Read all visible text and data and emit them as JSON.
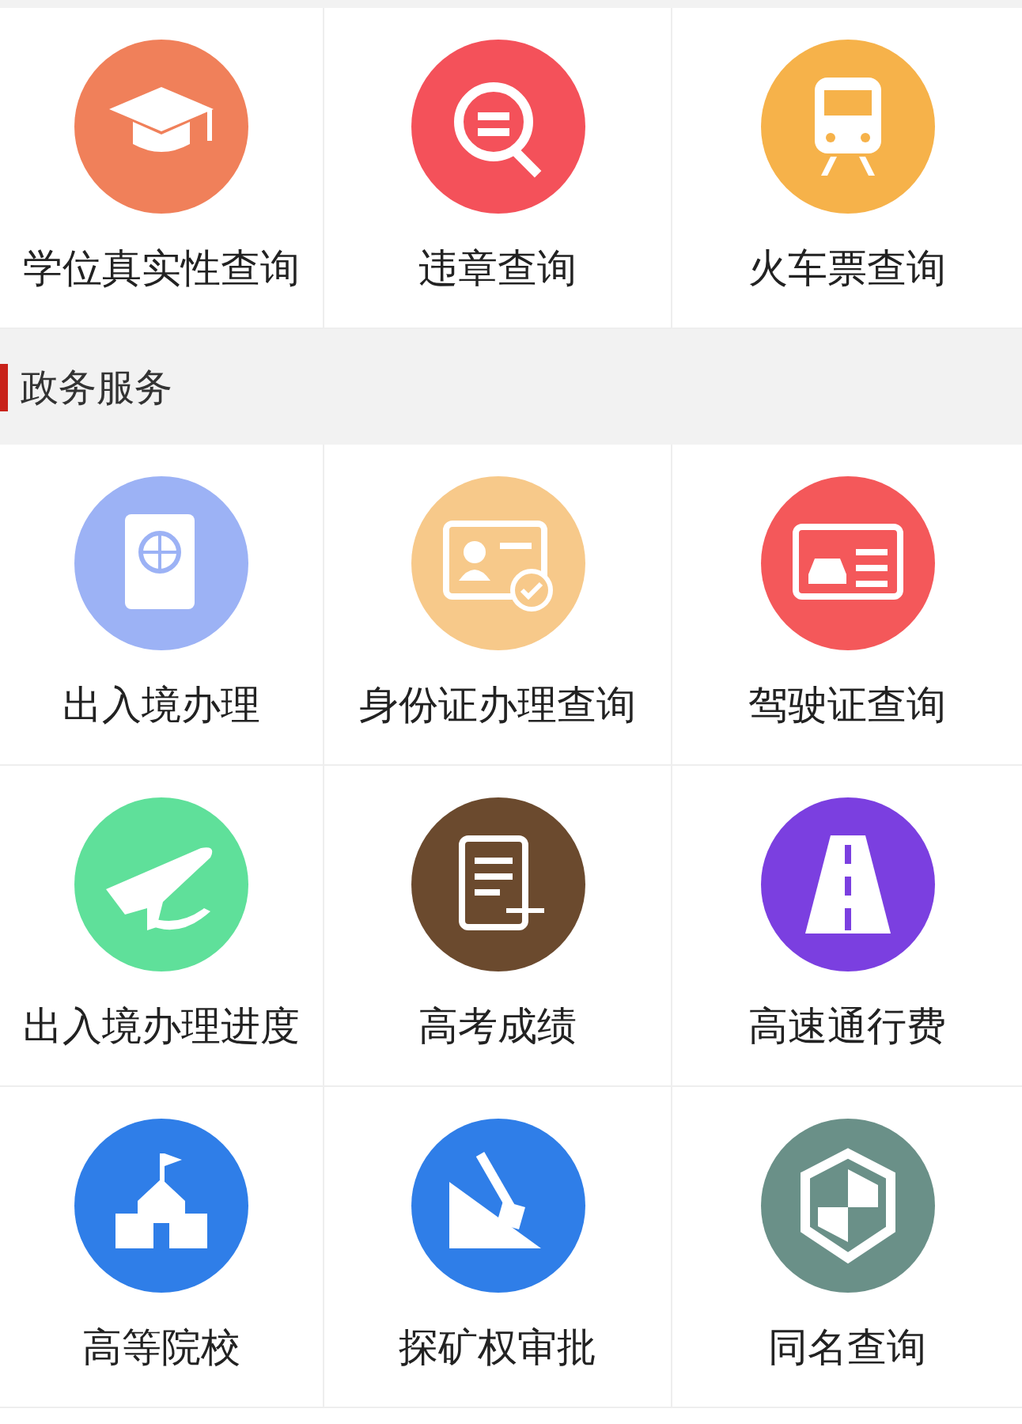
{
  "sections": [
    {
      "items": [
        {
          "label": "学位真实性查询",
          "color": "#f0805a"
        },
        {
          "label": "违章查询",
          "color": "#f4515a"
        },
        {
          "label": "火车票查询",
          "color": "#f6b24a"
        }
      ]
    },
    {
      "title": "政务服务",
      "items": [
        {
          "label": "出入境办理",
          "color": "#9cb2f5"
        },
        {
          "label": "身份证办理查询",
          "color": "#f7c98a"
        },
        {
          "label": "驾驶证查询",
          "color": "#f4585a"
        },
        {
          "label": "出入境办理进度",
          "color": "#5fe09a"
        },
        {
          "label": "高考成绩",
          "color": "#6b4a2e"
        },
        {
          "label": "高速通行费",
          "color": "#7b3fe0"
        },
        {
          "label": "高等院校",
          "color": "#2f7ee8"
        },
        {
          "label": "探矿权审批",
          "color": "#2f7ee8"
        },
        {
          "label": "同名查询",
          "color": "#6a9088"
        }
      ]
    }
  ]
}
